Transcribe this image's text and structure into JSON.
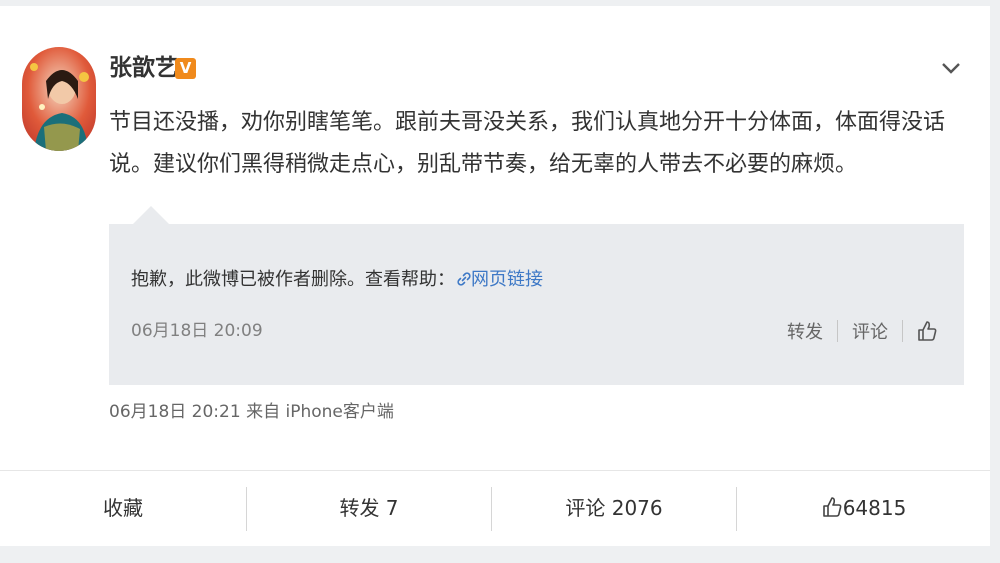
{
  "post": {
    "username": "张歆艺",
    "verified_badge": "V",
    "text": "节目还没播，劝你别瞎笔笔。跟前夫哥没关系，我们认真地分开十分体面，体面得没话说。建议你们黑得稍微走点心，别乱带节奏，给无辜的人带去不必要的麻烦。",
    "timestamp": "06月18日 20:21",
    "source": "来自 iPhone客户端",
    "icons": {
      "avatar": "avatar",
      "menu": "chevron-down-icon"
    }
  },
  "quote": {
    "deleted_text": "抱歉，此微博已被作者删除。查看帮助：",
    "link_text": "网页链接",
    "timestamp": "06月18日 20:09",
    "repost_label": "转发",
    "comment_label": "评论",
    "icons": {
      "link": "link-icon",
      "like": "thumbs-up-icon"
    }
  },
  "actions": {
    "favorite_label": "收藏",
    "repost_label": "转发 7",
    "comment_label": "评论 2076",
    "like_count": "64815"
  },
  "colors": {
    "accent_link": "#3d78c6",
    "badge": "#f08a1c",
    "quote_background": "#e9ebee"
  }
}
